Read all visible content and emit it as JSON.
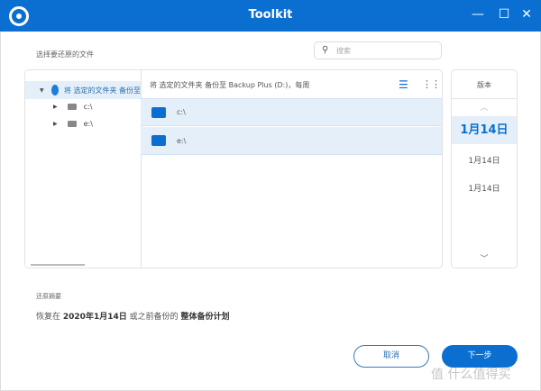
{
  "window": {
    "title": "Toolkit",
    "minimize": "—",
    "maximize": "☐",
    "close": "✕"
  },
  "select_label": "选择要还原的文件",
  "search": {
    "placeholder": "搜索"
  },
  "tree": {
    "root": "将 选定的文件夹 备份至",
    "children": [
      "c:\\",
      "e:\\"
    ]
  },
  "content": {
    "header": "将 选定的文件夹 备份至 Backup Plus (D:)，每周",
    "rows": [
      "c:\\",
      "e:\\"
    ]
  },
  "versions": {
    "header": "版本",
    "selected": "1月14日",
    "items": [
      "1月14日",
      "1月14日"
    ]
  },
  "summary": {
    "label": "还原摘要",
    "prefix": "恢复在",
    "date": "2020年1月14日",
    "middle": "或之前备份的",
    "plan": "整体备份计划"
  },
  "buttons": {
    "cancel": "取消",
    "next": "下一步"
  },
  "watermark": "值 什么值得买",
  "colors": {
    "accent": "#0a6fd1",
    "selected_row": "#e4effa"
  }
}
